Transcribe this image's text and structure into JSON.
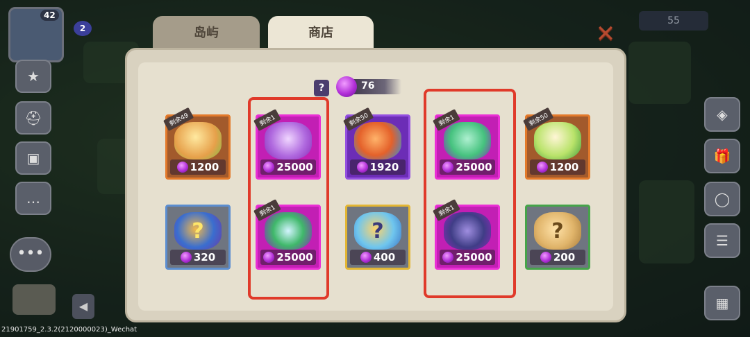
{
  "hud": {
    "level": "42",
    "notification_count": "2",
    "currency_right": "55",
    "more_label": "•••",
    "build_info": "21901759_2.3.2(2120000023)_Wechat"
  },
  "modal": {
    "tabs": [
      {
        "label": "岛屿",
        "active": false
      },
      {
        "label": "商店",
        "active": true
      }
    ],
    "close_label": "✕",
    "help_label": "?",
    "gem_balance": "76"
  },
  "shop_items": [
    {
      "name": "vine-egg",
      "price": "1200",
      "remaining": "剩余49",
      "frame": "orange",
      "icon": "egg-icon"
    },
    {
      "name": "castle-island",
      "price": "25000",
      "remaining": "剩余1",
      "frame": "magenta",
      "icon": "island-icon"
    },
    {
      "name": "fire-egg",
      "price": "1920",
      "remaining": "剩余50",
      "frame": "purple",
      "icon": "egg-icon"
    },
    {
      "name": "garden-island",
      "price": "25000",
      "remaining": "剩余1",
      "frame": "magenta",
      "icon": "island-icon"
    },
    {
      "name": "leaf-egg",
      "price": "1200",
      "remaining": "剩余50",
      "frame": "orange",
      "icon": "egg-icon"
    },
    {
      "name": "mystery-dragon-egg",
      "price": "320",
      "remaining": "",
      "frame": "blue",
      "icon": "mystery-egg-icon"
    },
    {
      "name": "rainbow-island",
      "price": "25000",
      "remaining": "剩余1",
      "frame": "magenta",
      "icon": "island-icon"
    },
    {
      "name": "crystal-mystery-egg",
      "price": "400",
      "remaining": "",
      "frame": "gold",
      "icon": "mystery-egg-icon"
    },
    {
      "name": "tower-island",
      "price": "25000",
      "remaining": "剩余1",
      "frame": "magenta",
      "icon": "island-icon"
    },
    {
      "name": "spiky-mystery-egg",
      "price": "200",
      "remaining": "",
      "frame": "green",
      "icon": "mystery-egg-icon"
    }
  ],
  "colors": {
    "highlight": "#e03a2a",
    "gem": "#b22fd8",
    "panel": "#d9d2c0"
  }
}
